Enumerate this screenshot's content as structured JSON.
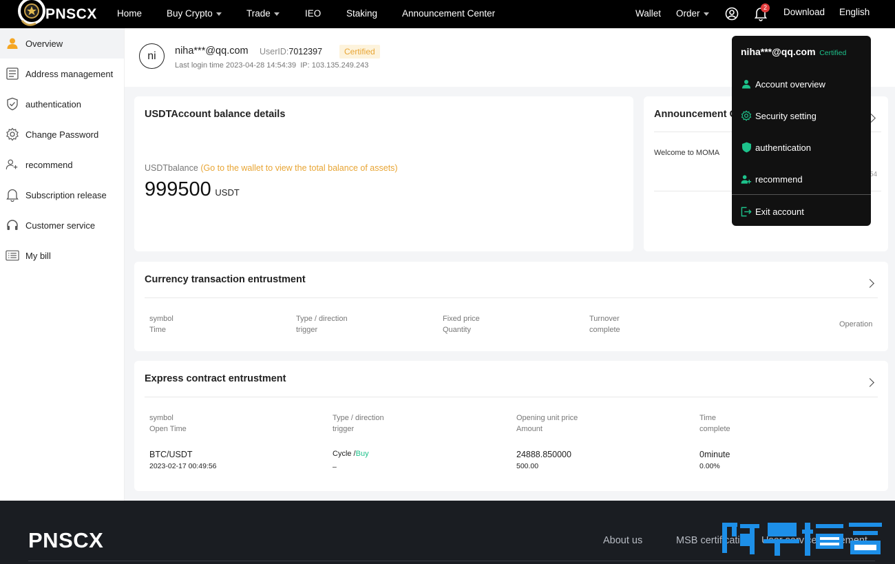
{
  "brand": {
    "name": "PNSCX"
  },
  "nav": {
    "home": "Home",
    "buy_crypto": "Buy Crypto",
    "trade": "Trade",
    "ieo": "IEO",
    "staking": "Staking",
    "announcement": "Announcement Center",
    "wallet": "Wallet",
    "order": "Order",
    "notification_count": "2",
    "download": "Download",
    "language": "English"
  },
  "sidebar": {
    "items": [
      {
        "label": "Overview",
        "icon": "user-icon"
      },
      {
        "label": "Address management",
        "icon": "list-icon"
      },
      {
        "label": "authentication",
        "icon": "shield-icon"
      },
      {
        "label": "Change Password",
        "icon": "gear-icon"
      },
      {
        "label": "recommend",
        "icon": "add-user-icon"
      },
      {
        "label": "Subscription release",
        "icon": "bell-icon"
      },
      {
        "label": "Customer service",
        "icon": "headset-icon"
      },
      {
        "label": "My bill",
        "icon": "bill-icon"
      }
    ]
  },
  "user": {
    "avatar_initials": "ni",
    "email": "niha***@qq.com",
    "userid_label": "UserID:",
    "userid": "7012397",
    "certified": "Certified",
    "last_login": "Last login time 2023-04-28 14:54:39",
    "ip": "IP: 103.135.249.243"
  },
  "balance": {
    "title": "USDTAccount balance details",
    "label": "USDTbalance",
    "link": "(Go to the wallet to view the total balance of assets)",
    "amount": "999500",
    "unit": "USDT"
  },
  "announcement": {
    "title": "Announcement C",
    "item": "Welcome to MOMA",
    "time_fragment": "54"
  },
  "currency_entrustment": {
    "title": "Currency transaction entrustment",
    "columns": [
      [
        "symbol",
        "Time"
      ],
      [
        "Type / direction",
        "trigger"
      ],
      [
        "Fixed price",
        "Quantity"
      ],
      [
        "Turnover",
        "complete"
      ]
    ],
    "operation": "Operation"
  },
  "contract_entrustment": {
    "title": "Express contract entrustment",
    "columns": [
      [
        "symbol",
        "Open Time"
      ],
      [
        "Type / direction",
        "trigger"
      ],
      [
        "Opening unit price",
        "Amount"
      ],
      [
        "Time",
        "complete"
      ]
    ],
    "row": {
      "symbol": "BTC/USDT",
      "open_time": "2023-02-17 00:49:56",
      "type": "Cycle /",
      "direction": "Buy",
      "trigger": "–",
      "price": "24888.850000",
      "amount": "500.00",
      "time": "0minute",
      "complete": "0.00%"
    }
  },
  "dropdown": {
    "email": "niha***@qq.com",
    "certified": "Certified",
    "items": [
      {
        "label": "Account overview",
        "icon": "user-icon"
      },
      {
        "label": "Security setting",
        "icon": "gear-icon"
      },
      {
        "label": "authentication",
        "icon": "shield-icon"
      },
      {
        "label": "recommend",
        "icon": "add-user-icon"
      },
      {
        "label": "Exit account",
        "icon": "logout-icon"
      }
    ]
  },
  "footer": {
    "logo": "PNSCX",
    "about": "About us",
    "msb": "MSB certification",
    "service": "User service agreement"
  },
  "colors": {
    "accent_green": "#1dc28b",
    "gold": "#e8a534",
    "dark": "#000000"
  }
}
